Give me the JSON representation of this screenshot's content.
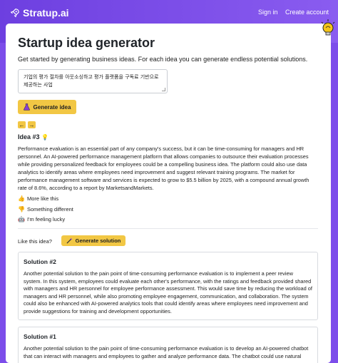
{
  "header": {
    "app_name": "Stratup.ai",
    "sign_in": "Sign in",
    "create_account": "Create account",
    "accent_color": "#7c4dea"
  },
  "main": {
    "title": "Startup idea generator",
    "subtitle": "Get started by generating business ideas. For each idea you can generate endless potential solutions.",
    "input_value": "기업의 평가 절차를 아웃소싱하고 평가 플랫폼을 구독료 기반으로 제공하는 사업",
    "generate_label": "Generate idea",
    "prev_symbol": "←",
    "next_symbol": "→",
    "button_color": "#f2c744"
  },
  "idea": {
    "title": "Idea #3",
    "emoji": "💡",
    "text": "Performance evaluation is an essential part of any company's success, but it can be time-consuming for managers and HR personnel. An AI-powered performance management platform that allows companies to outsource their evaluation processes while providing personalized feedback for employees could be a compelling business idea. The platform could also use data analytics to identify areas where employees need improvement and suggest relevant training programs. The market for performance management software and services is expected to grow to $5.5 billion by 2025, with a compound annual growth rate of 8.6%, according to a report by MarketsandMarkets.",
    "more_like_this": "More like this",
    "something_different": "Something different",
    "feeling_lucky": "I'm feeling lucky",
    "more_emoji": "👍",
    "different_emoji": "👎",
    "lucky_emoji": "🤖"
  },
  "solutions": {
    "like_prompt": "Like this idea?",
    "generate_label": "Generate solution",
    "items": [
      {
        "title": "Solution #2",
        "text": "Another potential solution to the pain point of time-consuming performance evaluation is to implement a peer review system. In this system, employees could evaluate each other's performance, with the ratings and feedback provided shared with managers and HR personnel for employee performance assessment. This would save time by reducing the workload of managers and HR personnel, while also promoting employee engagement, communication, and collaboration. The system could also be enhanced with AI-powered analytics tools that could identify areas where employees need improvement and provide suggestions for training and development opportunities."
      },
      {
        "title": "Solution #1",
        "text": "Another potential solution to the pain point of time-consuming performance evaluation is to develop an AI-powered chatbot that can interact with managers and employees to gather and analyze performance data. The chatbot could use natural"
      }
    ]
  }
}
